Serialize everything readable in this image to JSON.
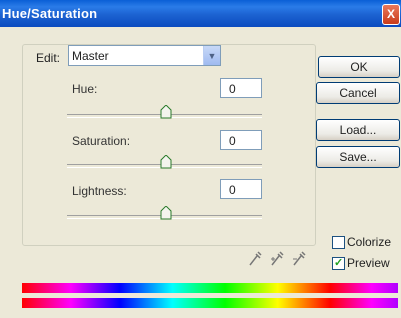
{
  "window": {
    "title": "Hue/Saturation",
    "close_label": "X"
  },
  "edit": {
    "label": "Edit:",
    "selected": "Master"
  },
  "sliders": [
    {
      "label": "Hue:",
      "value": "0"
    },
    {
      "label": "Saturation:",
      "value": "0"
    },
    {
      "label": "Lightness:",
      "value": "0"
    }
  ],
  "buttons": {
    "ok": "OK",
    "cancel": "Cancel",
    "load": "Load...",
    "save": "Save..."
  },
  "options": {
    "colorize": "Colorize",
    "colorize_checked": false,
    "preview": "Preview",
    "preview_checked": true
  },
  "eyedroppers": [
    "eyedropper-icon",
    "eyedropper-plus-icon",
    "eyedropper-minus-icon"
  ]
}
